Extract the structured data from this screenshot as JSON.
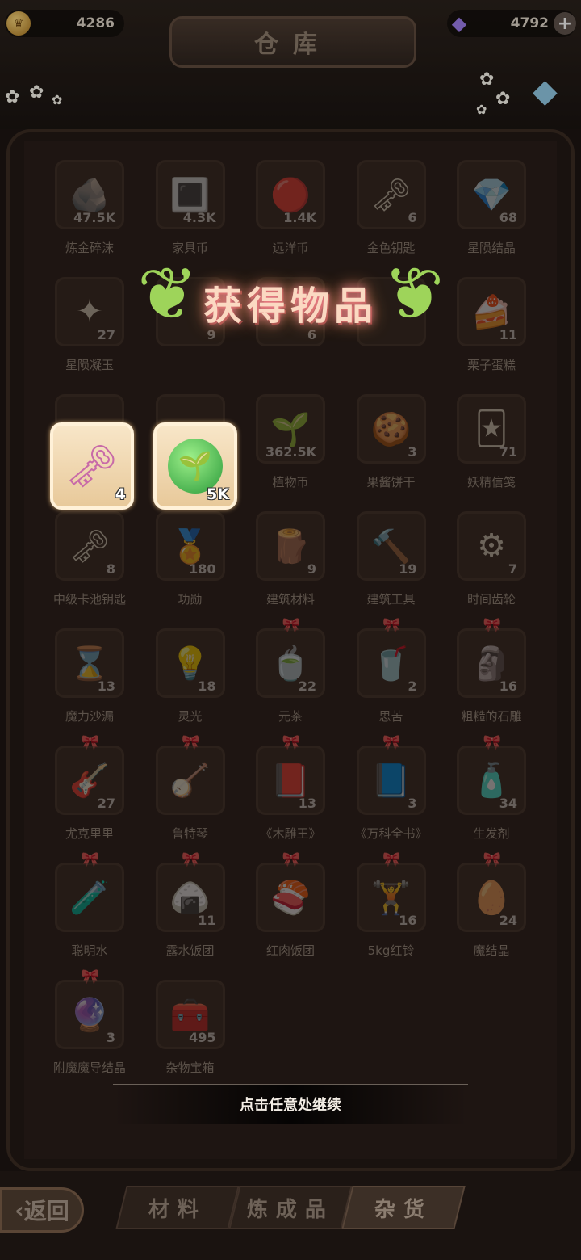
{
  "header": {
    "title": "仓库",
    "coins": "4286",
    "gems": "4792",
    "coin_icon": "crown-coin-icon",
    "gem_icon": "purple-gem-icon",
    "add_icon": "plus-icon"
  },
  "popup": {
    "title": "获得物品",
    "continue_text": "点击任意处继续",
    "rewards": [
      {
        "icon": "pink-ornate-key-icon",
        "qty": "4"
      },
      {
        "icon": "green-sprout-coin-icon",
        "qty": "5K"
      }
    ]
  },
  "items": [
    {
      "name": "炼金碎沫",
      "qty": "47.5K",
      "icon": "🪨",
      "bow": false
    },
    {
      "name": "家具币",
      "qty": "4.3K",
      "icon": "🔳",
      "bow": false
    },
    {
      "name": "远洋币",
      "qty": "1.4K",
      "icon": "🔴",
      "bow": false
    },
    {
      "name": "金色钥匙",
      "qty": "6",
      "icon": "🗝",
      "bow": false
    },
    {
      "name": "星陨结晶",
      "qty": "68",
      "icon": "💎",
      "bow": false
    },
    {
      "name": "星陨凝玉",
      "qty": "27",
      "icon": "✦",
      "bow": false
    },
    {
      "name": "",
      "qty": "9",
      "icon": "",
      "bow": false
    },
    {
      "name": "",
      "qty": "6",
      "icon": "",
      "bow": false
    },
    {
      "name": "",
      "qty": "",
      "icon": "",
      "bow": false
    },
    {
      "name": "栗子蛋糕",
      "qty": "11",
      "icon": "🍰",
      "bow": false
    },
    {
      "name": "",
      "qty": "",
      "icon": "",
      "bow": false
    },
    {
      "name": "",
      "qty": "",
      "icon": "",
      "bow": false
    },
    {
      "name": "植物币",
      "qty": "362.5K",
      "icon": "🌱",
      "bow": false
    },
    {
      "name": "果酱饼干",
      "qty": "3",
      "icon": "🍪",
      "bow": false
    },
    {
      "name": "妖精信笺",
      "qty": "71",
      "icon": "🃏",
      "bow": false
    },
    {
      "name": "中级卡池钥匙",
      "qty": "8",
      "icon": "🗝",
      "bow": false
    },
    {
      "name": "功勋",
      "qty": "180",
      "icon": "🏅",
      "bow": false
    },
    {
      "name": "建筑材料",
      "qty": "9",
      "icon": "🪵",
      "bow": false
    },
    {
      "name": "建筑工具",
      "qty": "19",
      "icon": "🔨",
      "bow": false
    },
    {
      "name": "时间齿轮",
      "qty": "7",
      "icon": "⚙",
      "bow": false
    },
    {
      "name": "魔力沙漏",
      "qty": "13",
      "icon": "⌛",
      "bow": false
    },
    {
      "name": "灵光",
      "qty": "18",
      "icon": "💡",
      "bow": false
    },
    {
      "name": "元茶",
      "qty": "22",
      "icon": "🍵",
      "bow": true
    },
    {
      "name": "思苦",
      "qty": "2",
      "icon": "🥤",
      "bow": true
    },
    {
      "name": "粗糙的石雕",
      "qty": "16",
      "icon": "🗿",
      "bow": true
    },
    {
      "name": "尤克里里",
      "qty": "27",
      "icon": "🎸",
      "bow": true
    },
    {
      "name": "鲁特琴",
      "qty": "",
      "icon": "🪕",
      "bow": true
    },
    {
      "name": "《木雕王》",
      "qty": "13",
      "icon": "📕",
      "bow": true
    },
    {
      "name": "《万科全书》",
      "qty": "3",
      "icon": "📘",
      "bow": true
    },
    {
      "name": "生发剂",
      "qty": "34",
      "icon": "🧴",
      "bow": true
    },
    {
      "name": "聪明水",
      "qty": "",
      "icon": "🧪",
      "bow": true
    },
    {
      "name": "露水饭团",
      "qty": "11",
      "icon": "🍙",
      "bow": true
    },
    {
      "name": "红肉饭团",
      "qty": "",
      "icon": "🍣",
      "bow": true
    },
    {
      "name": "5kg红铃",
      "qty": "16",
      "icon": "🏋",
      "bow": true
    },
    {
      "name": "魔结晶",
      "qty": "24",
      "icon": "🥚",
      "bow": true
    },
    {
      "name": "附魔魔导结晶",
      "qty": "3",
      "icon": "🔮",
      "bow": true
    },
    {
      "name": "杂物宝箱",
      "qty": "495",
      "icon": "🧰",
      "bow": false
    }
  ],
  "tabs": [
    "材料",
    "炼成品",
    "杂货"
  ],
  "back_label": "返回"
}
